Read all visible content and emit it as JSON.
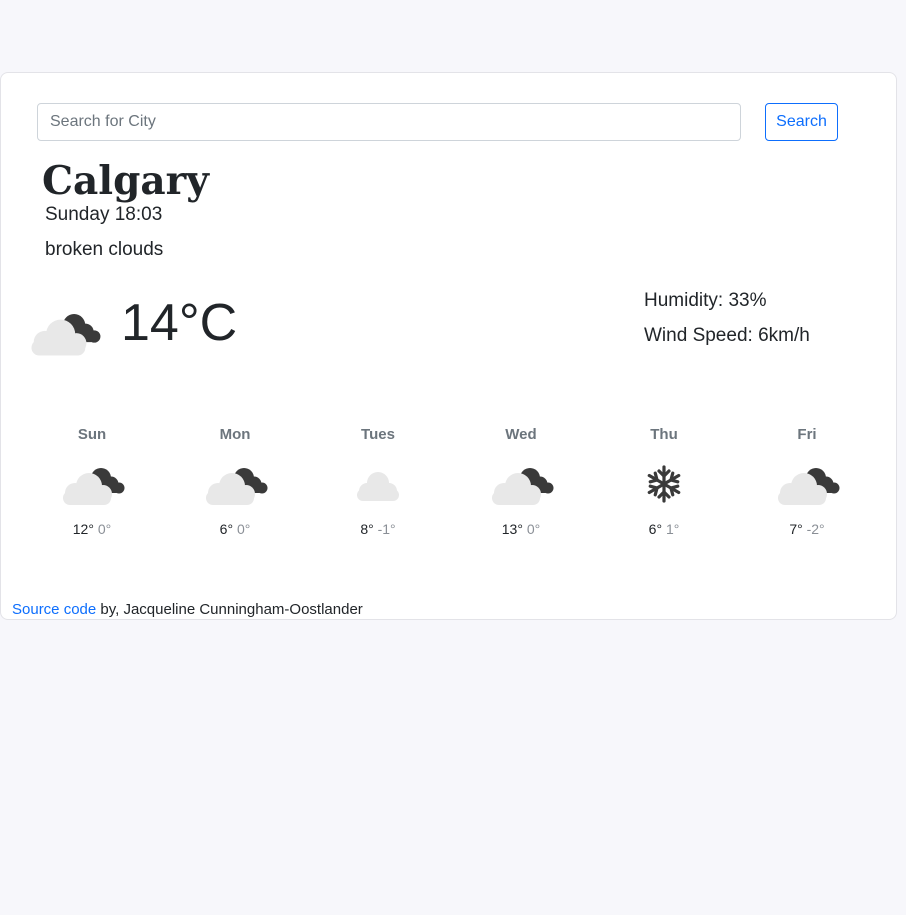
{
  "search": {
    "placeholder": "Search for City",
    "value": "",
    "button_label": "Search"
  },
  "current": {
    "city": "Calgary",
    "datetime": "Sunday 18:03",
    "description": "broken clouds",
    "temperature": "14°C",
    "icon": "broken-clouds-icon",
    "humidity": "Humidity: 33%",
    "wind": "Wind Speed: 6km/h"
  },
  "forecast": [
    {
      "day": "Sun",
      "max": "12°",
      "min": "0°",
      "icon": "broken-clouds-icon"
    },
    {
      "day": "Mon",
      "max": "6°",
      "min": "0°",
      "icon": "broken-clouds-icon"
    },
    {
      "day": "Tues",
      "max": "8°",
      "min": "-1°",
      "icon": "cloud-icon"
    },
    {
      "day": "Wed",
      "max": "13°",
      "min": "0°",
      "icon": "broken-clouds-icon"
    },
    {
      "day": "Thu",
      "max": "6°",
      "min": "1°",
      "icon": "snowflake-icon"
    },
    {
      "day": "Fri",
      "max": "7°",
      "min": "-2°",
      "icon": "broken-clouds-icon"
    }
  ],
  "footer": {
    "link_text": "Source code",
    "text": " by, Jacqueline Cunningham-Oostlander"
  },
  "colors": {
    "accent": "#0d6efd",
    "background": "#f7f7fb",
    "icon_dark": "#3a3a3a",
    "icon_light": "#e8e8e8"
  }
}
